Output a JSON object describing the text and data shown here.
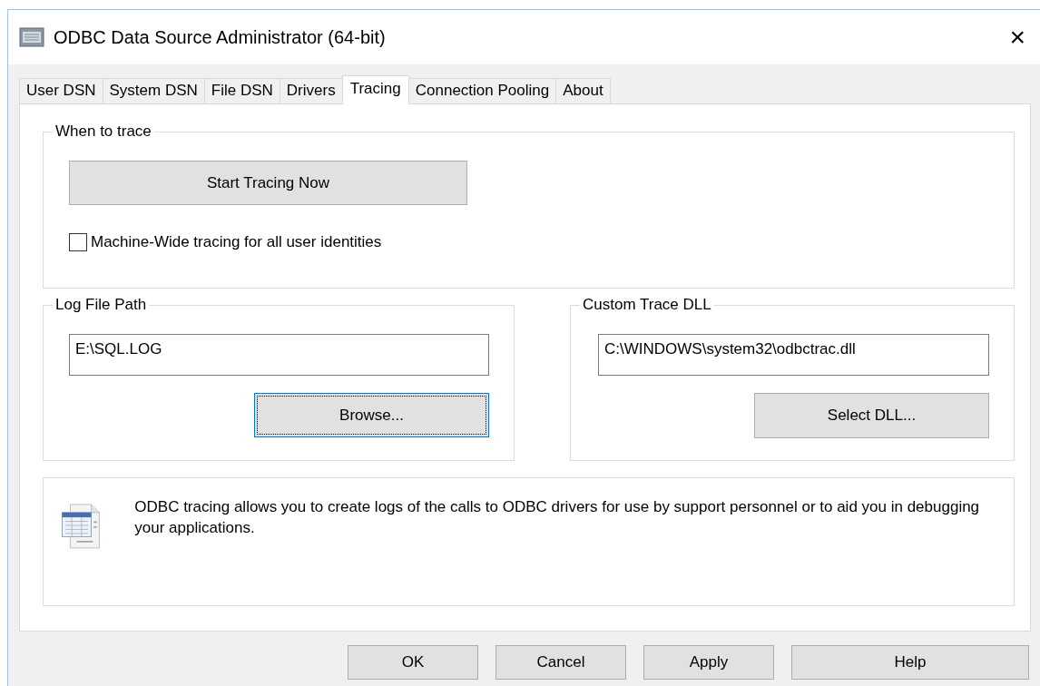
{
  "window": {
    "title": "ODBC Data Source Administrator (64-bit)",
    "close": "×"
  },
  "tabs": [
    {
      "label": "User DSN",
      "selected": false
    },
    {
      "label": "System DSN",
      "selected": false
    },
    {
      "label": "File DSN",
      "selected": false
    },
    {
      "label": "Drivers",
      "selected": false
    },
    {
      "label": "Tracing",
      "selected": true
    },
    {
      "label": "Connection Pooling",
      "selected": false
    },
    {
      "label": "About",
      "selected": false
    }
  ],
  "when_to_trace": {
    "title": "When to trace",
    "button": "Start Tracing Now",
    "checkbox": {
      "label": "Machine-Wide tracing for all user identities",
      "checked": false
    }
  },
  "log_file_path": {
    "title": "Log File Path",
    "value": "E:\\SQL.LOG",
    "button": "Browse...",
    "focused": true
  },
  "custom_trace_dll": {
    "title": "Custom Trace DLL",
    "value": "C:\\WINDOWS\\system32\\odbctrac.dll",
    "button": "Select DLL..."
  },
  "info": {
    "text": "ODBC tracing allows you to create logs of the calls to ODBC drivers for use by support personnel or to aid you in debugging your applications."
  },
  "buttons": [
    "OK",
    "Cancel",
    "Apply",
    "Help"
  ]
}
